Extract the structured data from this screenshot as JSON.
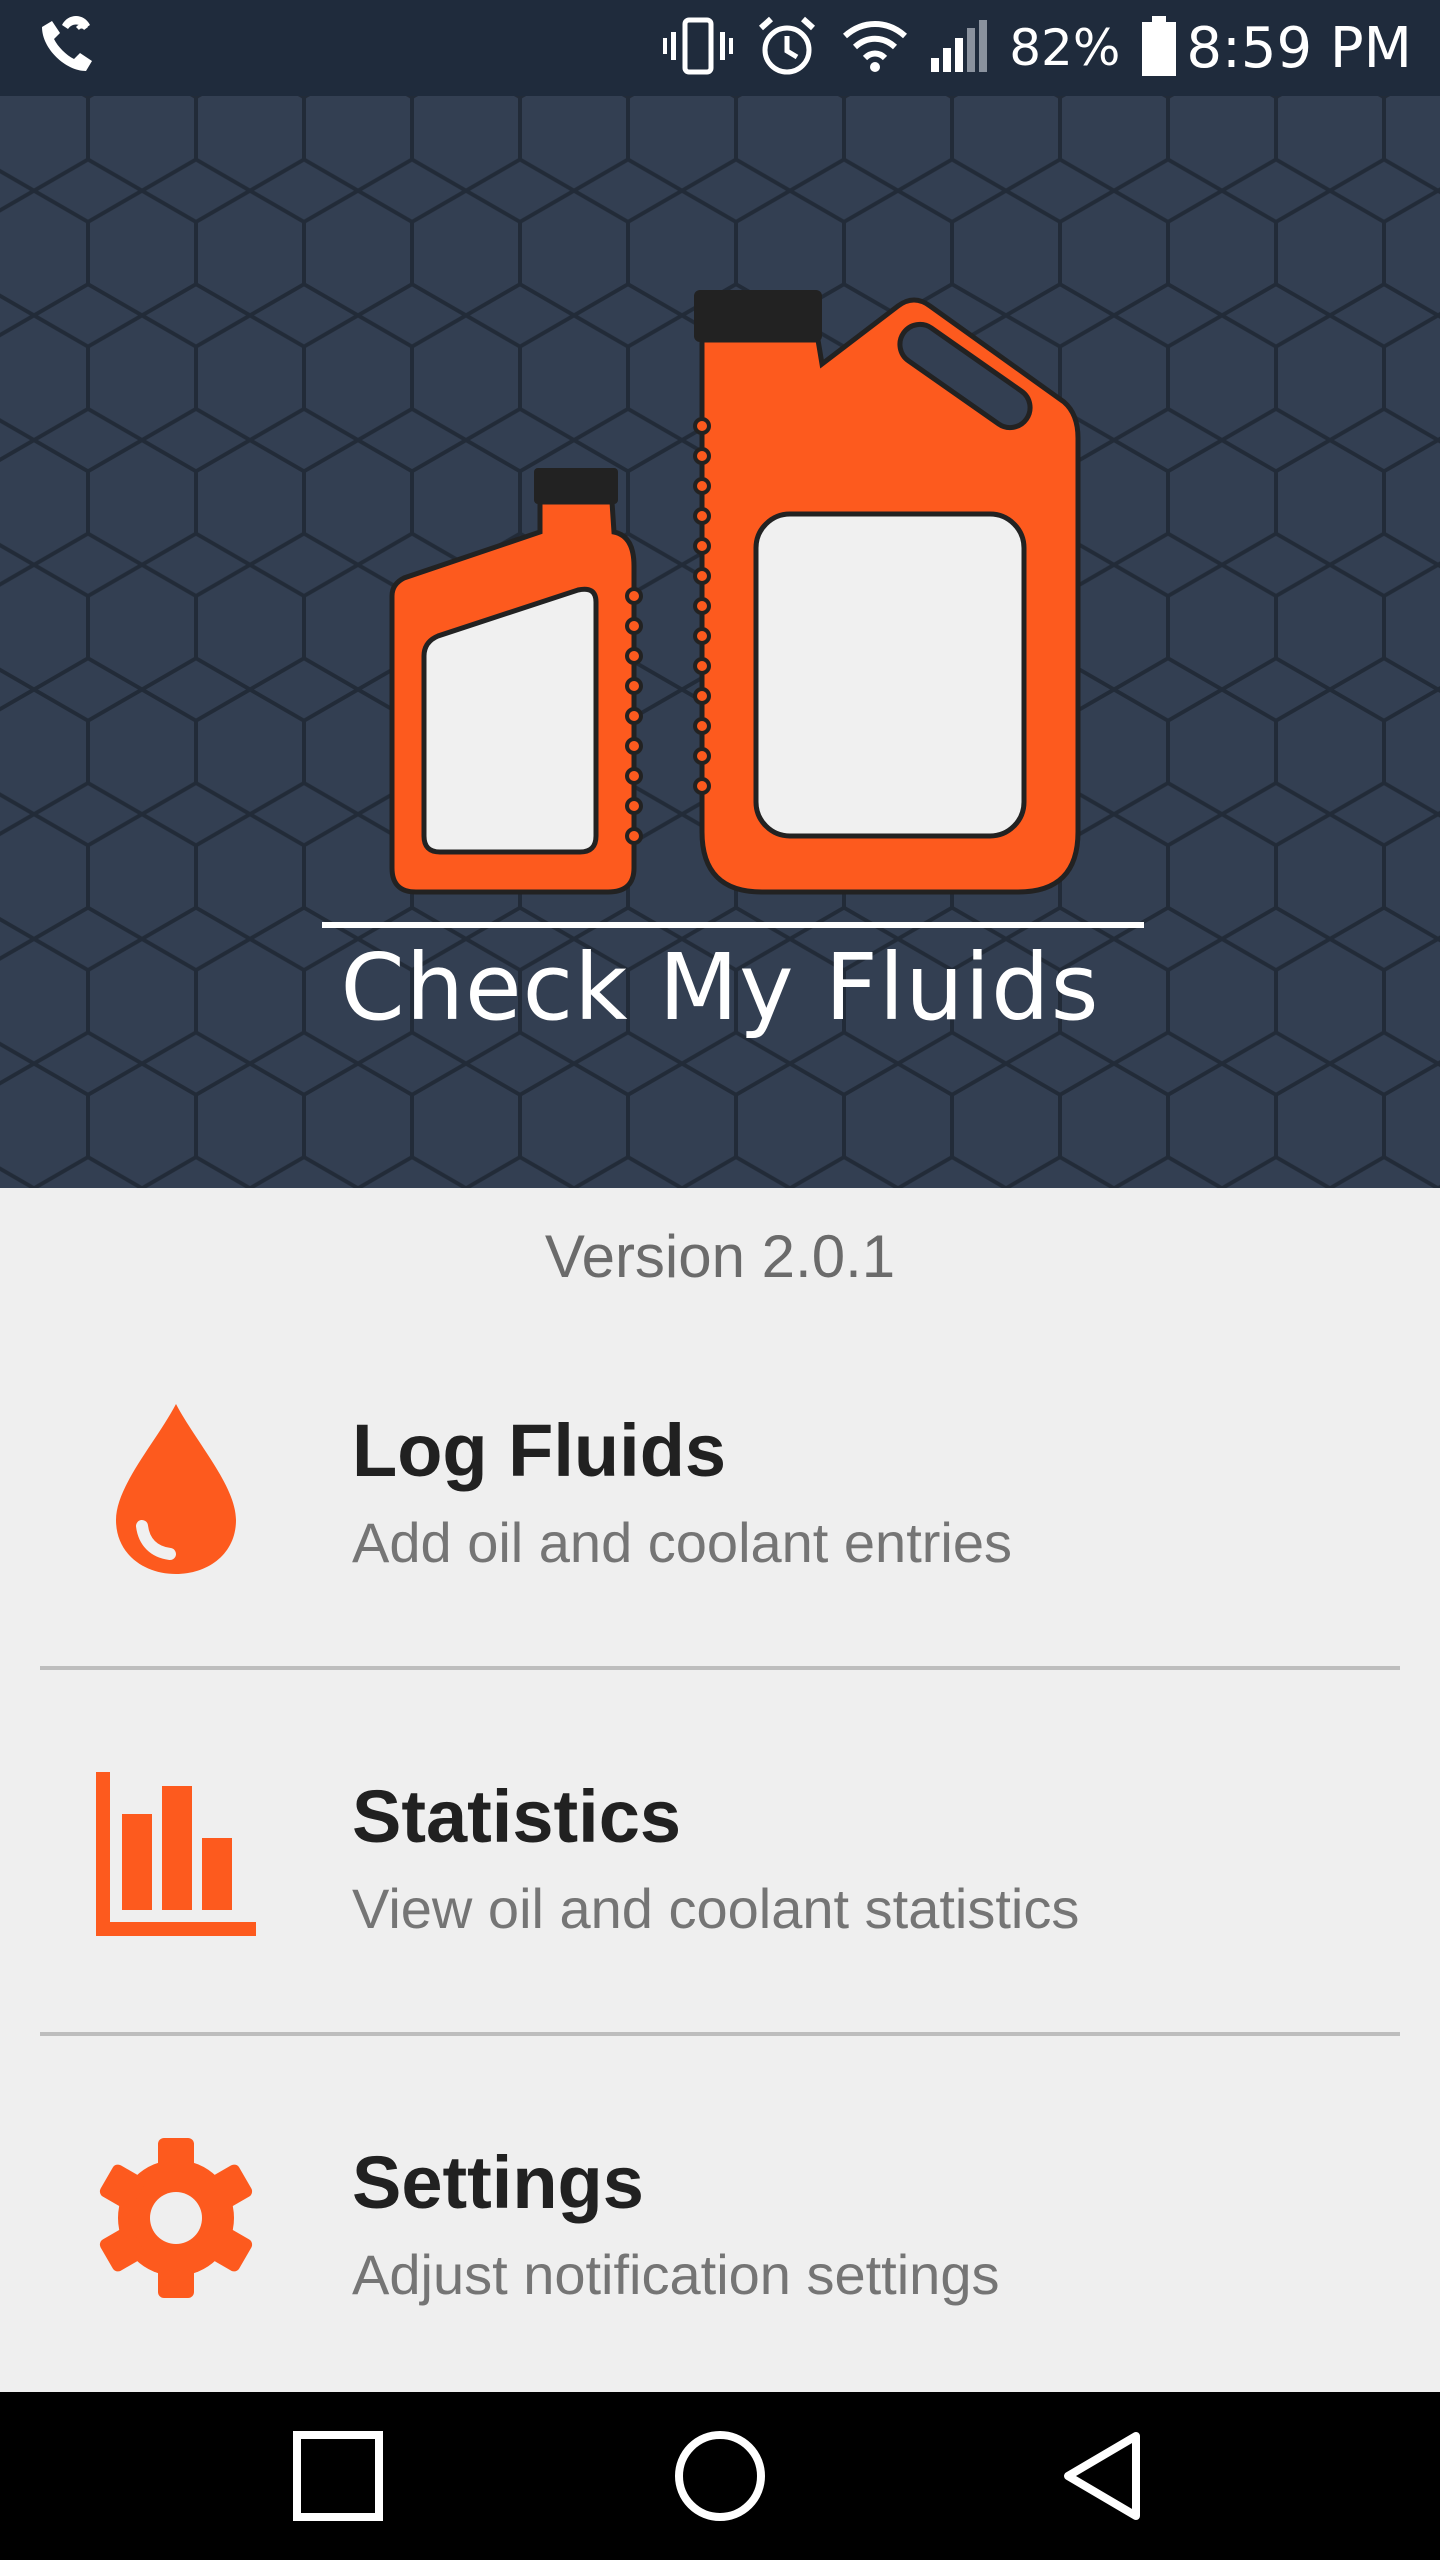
{
  "status_bar": {
    "battery": "82%",
    "time": "8:59 PM",
    "icons": [
      "wifi-calling-icon",
      "vibrate-icon",
      "alarm-icon",
      "wifi-icon",
      "signal-icon",
      "battery-icon"
    ]
  },
  "header": {
    "app_title": "Check My Fluids",
    "logo": "oil-bottles-logo"
  },
  "version": "Version 2.0.1",
  "menu": [
    {
      "title": "Log Fluids",
      "subtitle": "Add oil and coolant entries",
      "icon": "drop-icon"
    },
    {
      "title": "Statistics",
      "subtitle": "View oil and coolant statistics",
      "icon": "bar-chart-icon"
    },
    {
      "title": "Settings",
      "subtitle": "Adjust notification settings",
      "icon": "gear-icon"
    }
  ],
  "nav": [
    "recents-button",
    "home-button",
    "back-button"
  ],
  "colors": {
    "accent": "#fd5a1e",
    "header_bg": "#333f52",
    "status_bar_bg": "#1f2b3c",
    "page_bg": "#efefef"
  }
}
